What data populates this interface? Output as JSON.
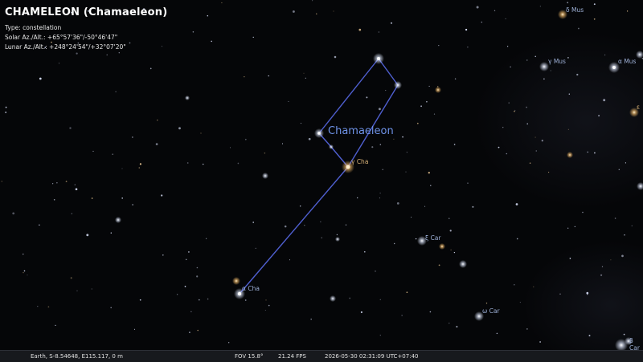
{
  "object_info": {
    "title": "CHAMELEON (Chamaeleon)",
    "type_line": "Type: constellation",
    "solar_line": "Solar Az./Alt.: +65°57'36\"/-50°46'47\"",
    "lunar_line": "Lunar Az./Alt.: +248°24'54\"/+32°07'20\""
  },
  "constellation_label": "Chamaeleon",
  "star_labels": {
    "delta_mus": "δ Mus",
    "gamma_mus": "γ Mus",
    "alpha_mus": "α Mus",
    "eps_mus": "ε",
    "gamma_cha": "γ Cha",
    "alpha_cha": "α Cha",
    "xi_car": "ξ Car",
    "omega_car": "ω Car",
    "beta_car": "β Car"
  },
  "status_bar": {
    "location": "Earth, S-8.54648, E115.117, 0 m",
    "fov": "FOV 15.8°",
    "fps": "21.24 FPS",
    "datetime": "2026-05-30 02:31:09 UTC+07:40"
  },
  "colors": {
    "sky": "#050608",
    "constellation_line": "#4f5fd0",
    "constellation_label": "#6f93e8",
    "star_label_blue": "#9fb2d9",
    "star_label_warm": "#d8b277"
  }
}
